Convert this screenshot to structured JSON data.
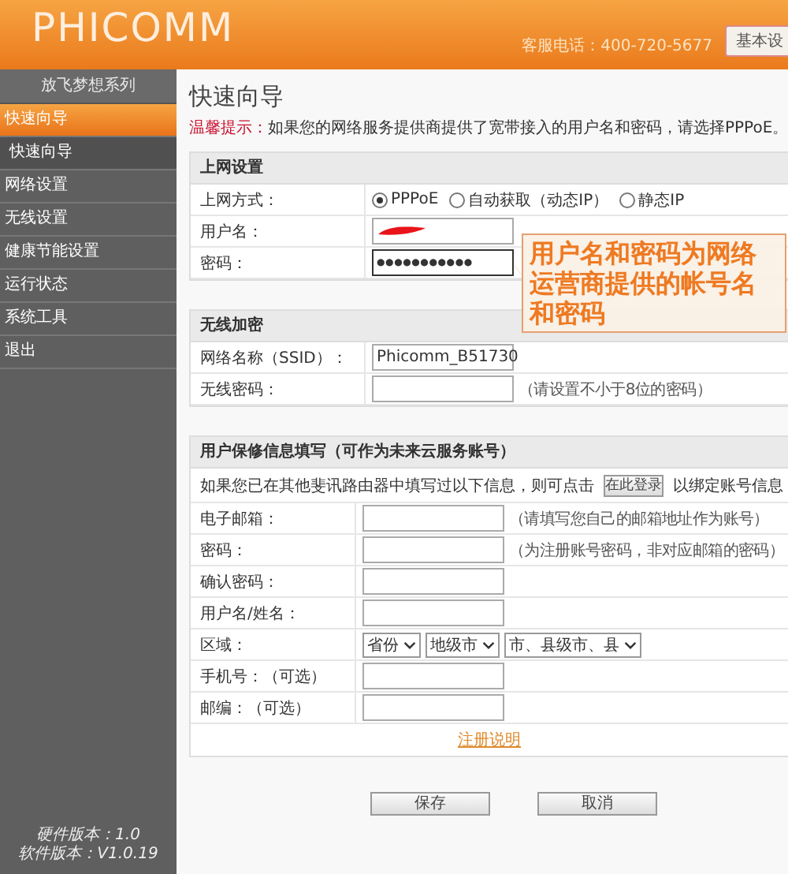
{
  "header": {
    "logo": "PHICOMM",
    "hotline": "客服电话：400-720-5677",
    "top_button": "基本设"
  },
  "sidebar": {
    "series": "放飞梦想系列",
    "items": [
      {
        "label": "快速向导",
        "selected": true,
        "children": [
          {
            "label": "快速向导",
            "selected": false
          }
        ]
      },
      {
        "label": "网络设置",
        "selected": false
      },
      {
        "label": "无线设置",
        "selected": false
      },
      {
        "label": "健康节能设置",
        "selected": false
      },
      {
        "label": "运行状态",
        "selected": false
      },
      {
        "label": "系统工具",
        "selected": false
      },
      {
        "label": "退出",
        "selected": false
      }
    ],
    "versions": [
      "硬件版本：1.0",
      "软件版本：V1.0.19"
    ]
  },
  "page_title": "快速向导",
  "hint": {
    "label": "温馨提示：",
    "text": "如果您的网络服务提供商提供了宽带接入的用户名和密码，请选择PPPoE。"
  },
  "internet": {
    "title": "上网设置",
    "mode_label": "上网方式：",
    "modes": [
      {
        "label": "PPPoE",
        "selected": true
      },
      {
        "label": "自动获取（动态IP）",
        "selected": false
      },
      {
        "label": "静态IP",
        "selected": false
      }
    ],
    "username_label": "用户名：",
    "password_label": "密码：",
    "password_value": "●●●●●●●●●●●"
  },
  "wireless": {
    "title": "无线加密",
    "ssid_label": "网络名称（SSID）：",
    "ssid_value": "Phicomm_B51730",
    "key_label": "无线密码：",
    "key_note": "（请设置不小于8位的密码）"
  },
  "account": {
    "title": "用户保修信息填写（可作为未来云服务账号）",
    "login_text": "如果您已在其他斐讯路由器中填写过以下信息，则可点击",
    "login_button": "在此登录",
    "login_after": "以绑定账号信息",
    "rows": [
      {
        "kind": "input",
        "label": "电子邮箱：",
        "note": "（请填写您自己的邮箱地址作为账号）"
      },
      {
        "kind": "input",
        "label": "密码：",
        "note": "（为注册账号密码，非对应邮箱的密码）"
      },
      {
        "kind": "input",
        "label": "确认密码："
      },
      {
        "kind": "input",
        "label": "用户名/姓名："
      },
      {
        "kind": "selects",
        "label": "区域：",
        "options": [
          "省份",
          "地级市",
          "市、县级市、县"
        ]
      },
      {
        "kind": "input",
        "label": "手机号：（可选）"
      },
      {
        "kind": "input",
        "label": "邮编：（可选）"
      }
    ],
    "link": "注册说明"
  },
  "buttons": [
    "保存",
    "取消"
  ],
  "callout": "用户名和密码为网络运营商提供的帐号名和密码"
}
